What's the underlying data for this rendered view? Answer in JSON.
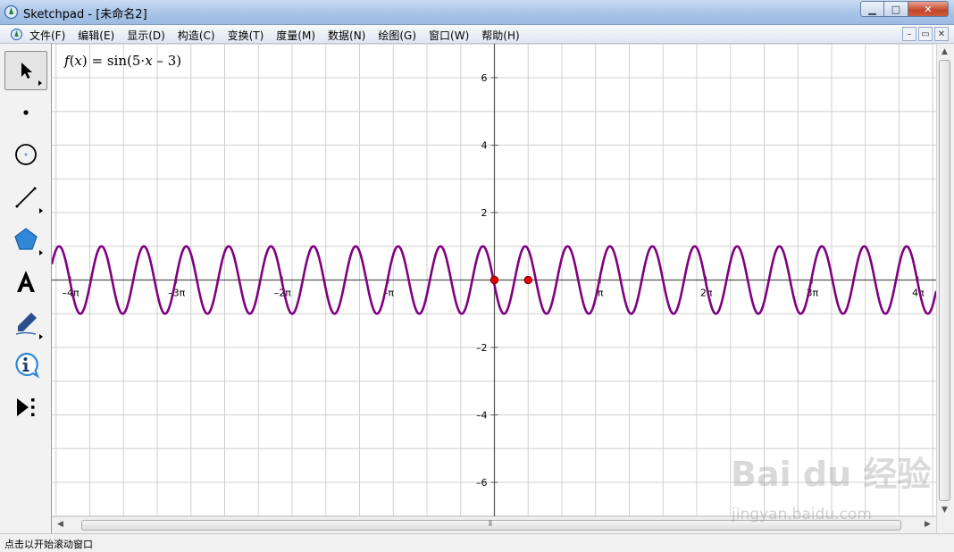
{
  "window": {
    "title": "Sketchpad  - [未命名2]",
    "controls": {
      "minimize": "▁",
      "maximize": "□",
      "close": "✕"
    }
  },
  "menu": {
    "items": [
      "文件(F)",
      "编辑(E)",
      "显示(D)",
      "构造(C)",
      "变换(T)",
      "度量(M)",
      "数据(N)",
      "绘图(G)",
      "窗口(W)",
      "帮助(H)"
    ],
    "doc_controls": [
      "–",
      "▭",
      "✕"
    ]
  },
  "toolbox": {
    "tools": [
      "arrow-select-tool-icon",
      "point-tool-icon",
      "compass-tool-icon",
      "straightedge-tool-icon",
      "polygon-tool-icon",
      "text-tool-icon",
      "marker-tool-icon",
      "information-tool-icon",
      "custom-tool-icon"
    ],
    "active_tool": "arrow-select-tool-icon"
  },
  "graph": {
    "function_label": {
      "name": "f",
      "var": "x",
      "expr_head": "sin(5·",
      "expr_tail": " – 3)"
    },
    "x_ticks": [
      "–4π",
      "–3π",
      "–2π",
      "–π",
      "π",
      "2π",
      "3π",
      "4π"
    ],
    "y_ticks": [
      "6",
      "4",
      "2",
      "–2",
      "–4",
      "–6"
    ],
    "colors": {
      "curve": "#800080",
      "axes": "#555555",
      "grid": "#d0d0d0",
      "point": "#e60000"
    }
  },
  "chart_data": {
    "type": "line",
    "title": "",
    "xlabel": "",
    "ylabel": "",
    "function": "f(x) = sin(5·x – 3)",
    "xlim": [
      -13.25,
      13.05
    ],
    "ylim": [
      -7,
      7
    ],
    "x_tick_values": [
      "-4π",
      "-3π",
      "-2π",
      "-π",
      "π",
      "2π",
      "3π",
      "4π"
    ],
    "y_tick_values": [
      -6,
      -4,
      -2,
      2,
      4,
      6
    ],
    "grid": true,
    "points": [
      {
        "x": 0,
        "y": 0
      },
      {
        "x": 1,
        "y": 0
      }
    ],
    "series": [
      {
        "amplitude": 1,
        "frequency": 5,
        "phase": -3
      }
    ]
  },
  "statusbar": {
    "text": "点击以开始滚动窗口"
  },
  "watermark": {
    "logo": "Bai du 经验",
    "url": "jingyan.baidu.com"
  }
}
